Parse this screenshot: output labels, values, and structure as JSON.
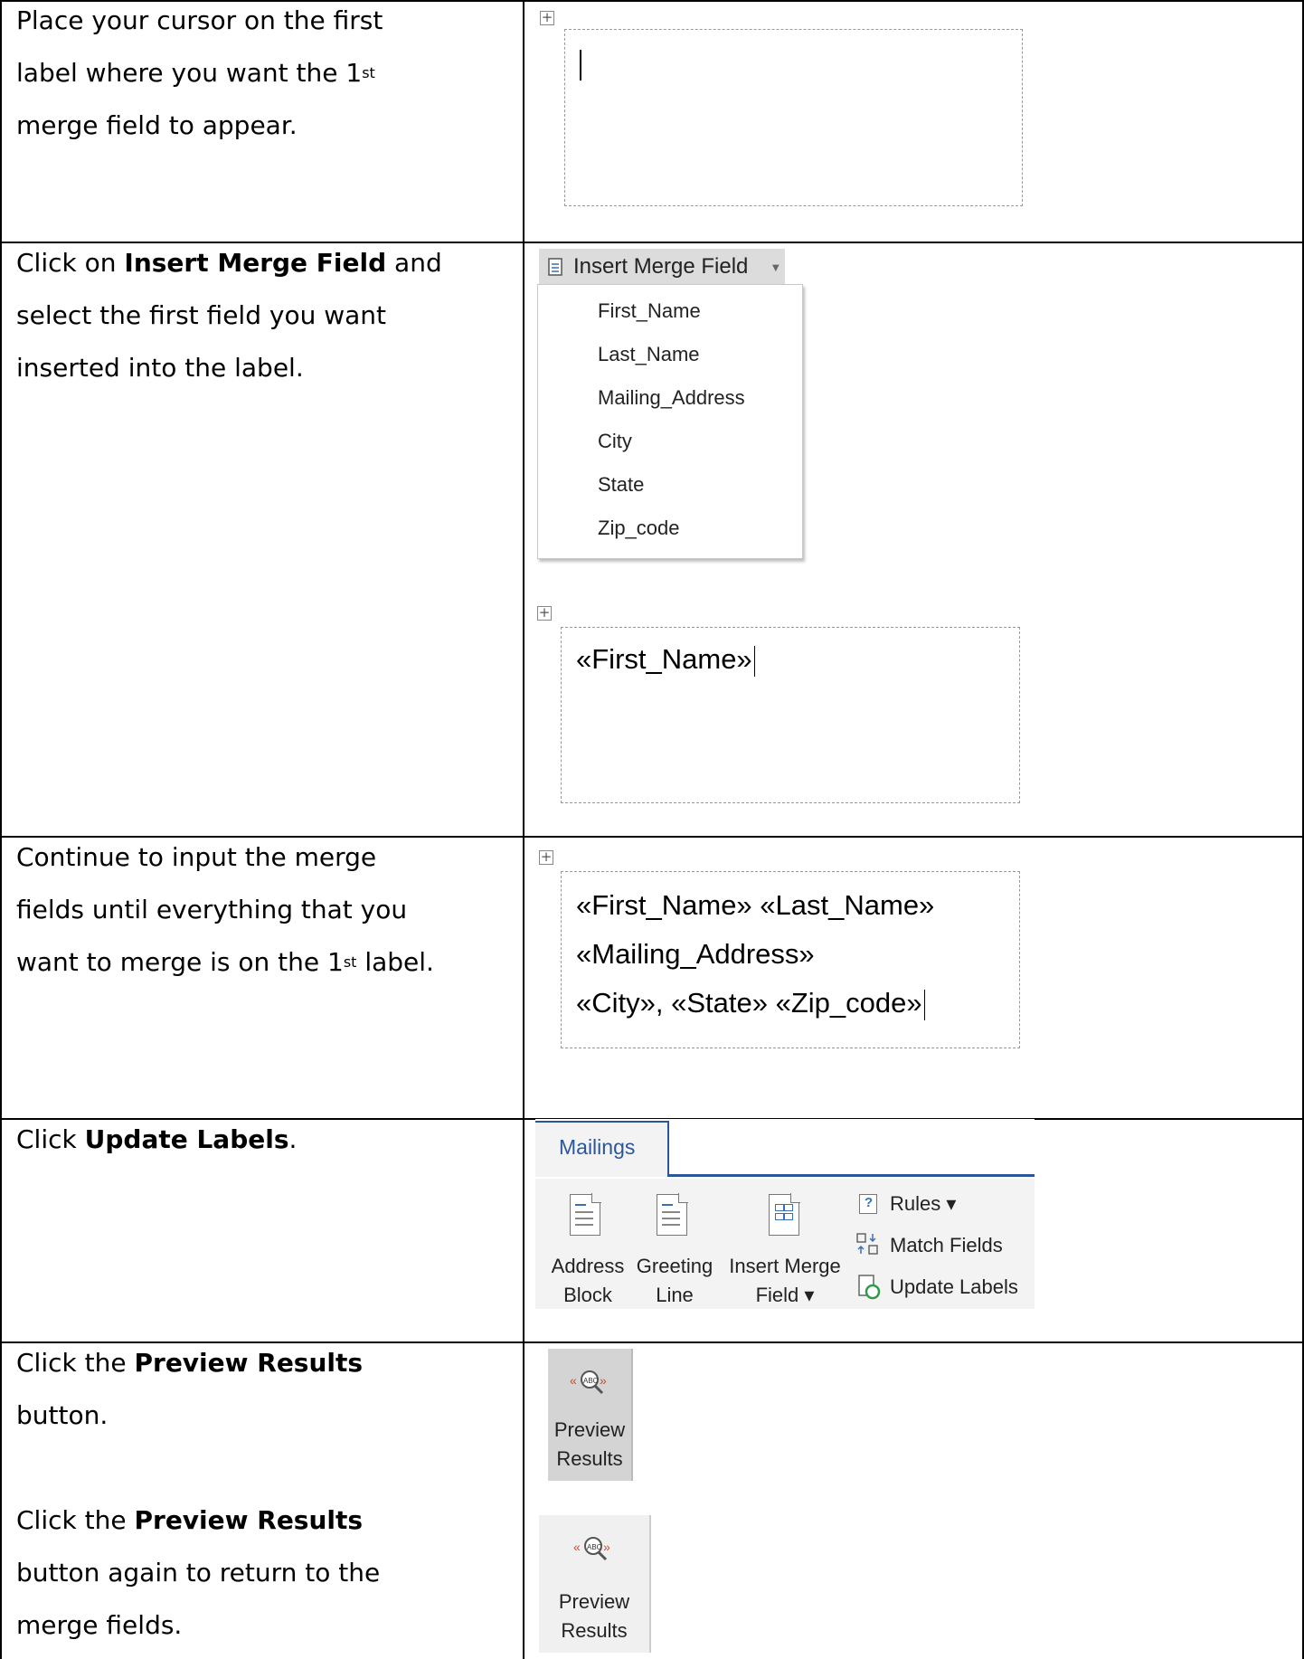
{
  "rows": [
    {
      "id": "r1",
      "text": [
        "Place your cursor on the first",
        "label where you want the 1",
        "merge field to appear."
      ],
      "sup": "st"
    },
    {
      "id": "r2",
      "pre": "Click on ",
      "bold": "Insert Merge Field",
      "post": " and",
      "lines": [
        "select the first field you want",
        "inserted into the label."
      ]
    },
    {
      "id": "r3",
      "lines": [
        "Continue to input the merge",
        "fields until everything that you"
      ],
      "last_pre": "want to merge is on the 1",
      "sup": "st",
      "last_post": " label."
    },
    {
      "id": "r4",
      "pre": "Click ",
      "bold": "Update Labels",
      "post": "."
    },
    {
      "id": "r5",
      "pre": "Click the ",
      "bold": "Preview Results",
      "line2": "button.",
      "pre2": "Click the ",
      "bold2": "Preview Results",
      "lines2": [
        "button again to return to the",
        "merge fields."
      ]
    }
  ],
  "insert_merge_field": {
    "button_label": "Insert Merge Field",
    "menu_items": [
      "First_Name",
      "Last_Name",
      "Mailing_Address",
      "City",
      "State",
      "Zip_code"
    ]
  },
  "label_single": "«First_Name»",
  "label_full": [
    "«First_Name» «Last_Name»",
    "«Mailing_Address»",
    "«City», «State» «Zip_code»"
  ],
  "ribbon": {
    "tab": "Mailings",
    "address_block": [
      "Address",
      "Block"
    ],
    "greeting_line": [
      "Greeting",
      "Line"
    ],
    "insert_merge_field": [
      "Insert Merge",
      "Field ▾"
    ],
    "rules": "Rules ▾",
    "match_fields": "Match Fields",
    "update_labels": "Update Labels",
    "accent": "#2b579a"
  },
  "preview_results": [
    "Preview",
    "Results"
  ],
  "icons": [
    "table-move-icon",
    "document-icon",
    "dropdown-arrow-icon",
    "rules-icon",
    "match-fields-icon",
    "update-labels-icon",
    "preview-abc-icon"
  ]
}
